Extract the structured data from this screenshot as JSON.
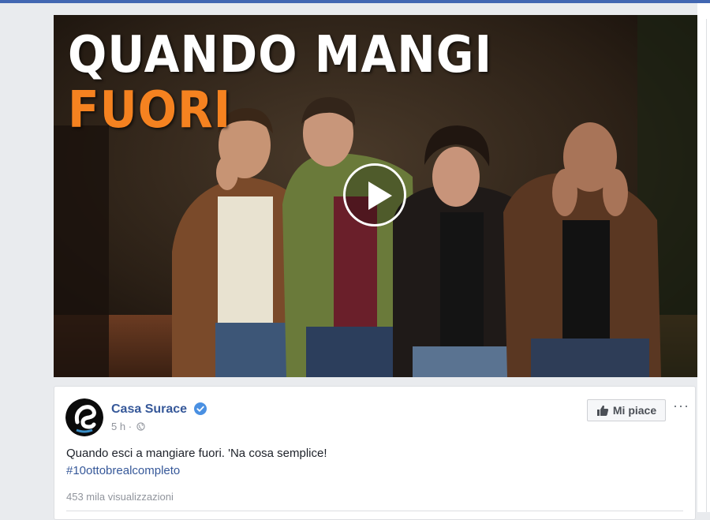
{
  "video": {
    "headline_line1": "QUANDO MANGI",
    "headline_line2": "FUORI",
    "headline_line2_color": "#f58220"
  },
  "post": {
    "page_name": "Casa Surace",
    "time": "5 h",
    "separator": "·",
    "text": "Quando esci a mangiare fuori. 'Na cosa semplice!",
    "hashtag": "#10ottobrealcompleto",
    "views": "453 mila visualizzazioni",
    "like_button_label": "Mi piace",
    "more_label": "···"
  },
  "icons": {
    "verified": "verified-badge-icon",
    "audience": "globe-icon",
    "like": "thumbs-up-icon",
    "more": "more-options-icon",
    "play": "play-icon"
  },
  "colors": {
    "brand_blue": "#4267b2",
    "link_blue": "#365899",
    "verified_blue": "#4a90e2"
  }
}
